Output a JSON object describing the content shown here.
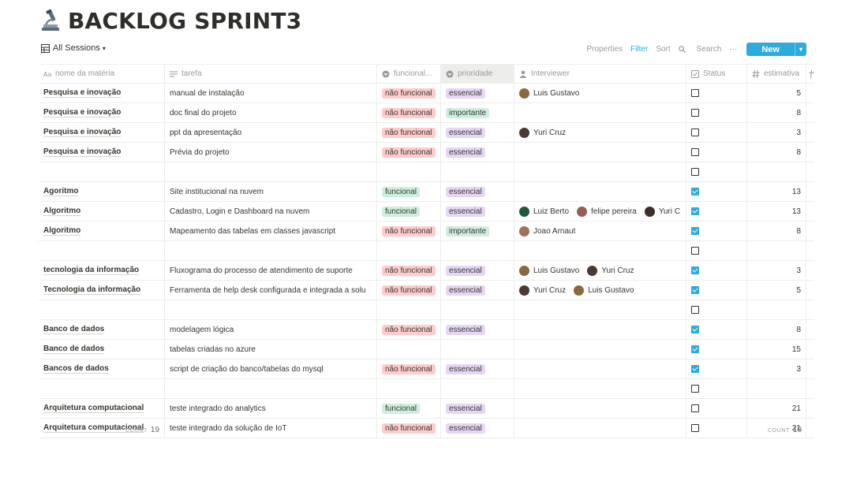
{
  "page": {
    "title": "BACKLOG SPRINT3",
    "icon": "microscope-icon"
  },
  "view": {
    "label": "All Sessions",
    "icon": "table-icon"
  },
  "toolbar": {
    "properties": "Properties",
    "filter": "Filter",
    "sort": "Sort",
    "search": "Search",
    "more": "···",
    "new": "New"
  },
  "columns": [
    {
      "label": "nome da matéria",
      "icon": "text-icon"
    },
    {
      "label": "tarefa",
      "icon": "lines-icon"
    },
    {
      "label": "funcional...",
      "icon": "select-icon"
    },
    {
      "label": "prioridade",
      "icon": "select-icon"
    },
    {
      "label": "Interviewer",
      "icon": "person-icon"
    },
    {
      "label": "Status",
      "icon": "checkbox-icon"
    },
    {
      "label": "estimativa",
      "icon": "hash-icon"
    }
  ],
  "colors": {
    "accent": "#2eaadc",
    "tag_nao_funcional": "#ffcccc",
    "tag_funcional": "#ccf0dc",
    "tag_essencial": "#e6d6f5",
    "tag_importante": "#cdeee0"
  },
  "rows": [
    {
      "materia": "Pesquisa e inovação",
      "tarefa": "manual de instalação",
      "funcional": "não funcional",
      "prioridade": "essencial",
      "interviewers": [
        {
          "name": "Luis Gustavo",
          "color": "#8a6a3c"
        }
      ],
      "status": false,
      "estimativa": "5"
    },
    {
      "materia": "Pesquisa e inovação",
      "tarefa": "doc final do projeto",
      "funcional": "não funcional",
      "prioridade": "importante",
      "interviewers": [],
      "status": false,
      "estimativa": "8"
    },
    {
      "materia": "Pesquisa e inovação",
      "tarefa": "ppt da apresentação",
      "funcional": "não funcional",
      "prioridade": "essencial",
      "interviewers": [
        {
          "name": "Yuri Cruz",
          "color": "#4a3a33"
        }
      ],
      "status": false,
      "estimativa": "3"
    },
    {
      "materia": "Pesquisa e inovação",
      "tarefa": "Prévia do projeto",
      "funcional": "não funcional",
      "prioridade": "essencial",
      "interviewers": [],
      "status": false,
      "estimativa": "8"
    },
    {
      "materia": "",
      "tarefa": "",
      "funcional": "",
      "prioridade": "",
      "interviewers": [],
      "status": false,
      "estimativa": ""
    },
    {
      "materia": "Agoritmo",
      "tarefa": "Site institucional na nuvem",
      "funcional": "funcional",
      "prioridade": "essencial",
      "interviewers": [],
      "status": true,
      "estimativa": "13"
    },
    {
      "materia": "Algoritmo",
      "tarefa": "Cadastro, Login e Dashboard na nuvem",
      "funcional": "funcional",
      "prioridade": "essencial",
      "interviewers": [
        {
          "name": "Luiz Berto",
          "color": "#1f5a3f"
        },
        {
          "name": "felipe pereira",
          "color": "#9a5b55"
        },
        {
          "name": "Yuri C",
          "color": "#3b2f2a"
        }
      ],
      "status": true,
      "estimativa": "13"
    },
    {
      "materia": "Algoritmo",
      "tarefa": "Mapeamento das tabelas em classes javascript",
      "funcional": "não funcional",
      "prioridade": "importante",
      "interviewers": [
        {
          "name": "Joao Arnaut",
          "color": "#a0715a"
        }
      ],
      "status": true,
      "estimativa": "8"
    },
    {
      "materia": "",
      "tarefa": "",
      "funcional": "",
      "prioridade": "",
      "interviewers": [],
      "status": false,
      "estimativa": ""
    },
    {
      "materia": "tecnologia da informação",
      "tarefa": "Fluxograma do processo de atendimento de suporte",
      "funcional": "não funcional",
      "prioridade": "essencial",
      "interviewers": [
        {
          "name": "Luis Gustavo",
          "color": "#8a6a3c"
        },
        {
          "name": "Yuri Cruz",
          "color": "#4a3a33"
        }
      ],
      "status": true,
      "estimativa": "3"
    },
    {
      "materia": "Tecnologia da informação",
      "tarefa": "Ferramenta de help desk configurada e integrada a solu",
      "funcional": "não funcional",
      "prioridade": "essencial",
      "interviewers": [
        {
          "name": "Yuri Cruz",
          "color": "#4a3a33"
        },
        {
          "name": "Luis Gustavo",
          "color": "#8a6a3c"
        }
      ],
      "status": true,
      "estimativa": "5"
    },
    {
      "materia": "",
      "tarefa": "",
      "funcional": "",
      "prioridade": "",
      "interviewers": [],
      "status": false,
      "estimativa": ""
    },
    {
      "materia": "Banco de dados",
      "tarefa": "modelagem lógica",
      "funcional": "não funcional",
      "prioridade": "essencial",
      "interviewers": [],
      "status": true,
      "estimativa": "8"
    },
    {
      "materia": "Banco de dados",
      "tarefa": "tabelas criadas no azure",
      "funcional": "",
      "prioridade": "",
      "interviewers": [],
      "status": true,
      "estimativa": "15"
    },
    {
      "materia": "Bancos de dados",
      "tarefa": "script de criação do banco/tabelas do mysql",
      "funcional": "não funcional",
      "prioridade": "essencial",
      "interviewers": [],
      "status": true,
      "estimativa": "3"
    },
    {
      "materia": "",
      "tarefa": "",
      "funcional": "",
      "prioridade": "",
      "interviewers": [],
      "status": false,
      "estimativa": ""
    },
    {
      "materia": "Arquitetura computacional",
      "tarefa": "teste integrado do analytics",
      "funcional": "funcional",
      "prioridade": "essencial",
      "interviewers": [],
      "status": false,
      "estimativa": "21"
    },
    {
      "materia": "Arquitetura computacional",
      "tarefa": "teste integrado da solução de IoT",
      "funcional": "não funcional",
      "prioridade": "essencial",
      "interviewers": [],
      "status": false,
      "estimativa": "21"
    }
  ],
  "footer": {
    "count_label": "COUNT",
    "count_left": "19",
    "count_right": "19"
  }
}
